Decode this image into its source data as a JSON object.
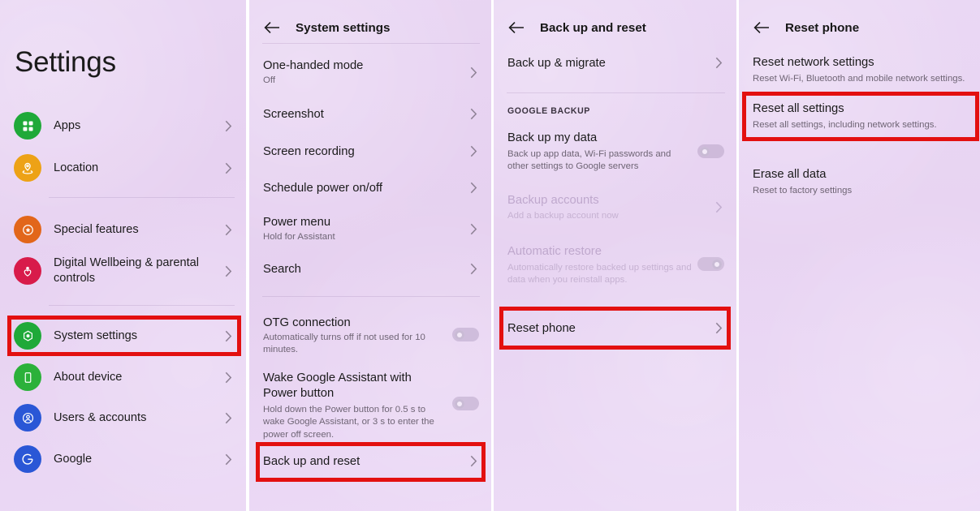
{
  "panels": {
    "settings": {
      "title": "Settings",
      "items": [
        {
          "label": "Apps",
          "icon": "apps-grid-icon",
          "color": "#1fa939"
        },
        {
          "label": "Location",
          "icon": "location-pin-icon",
          "color": "#eda216"
        },
        {
          "label": "Special features",
          "icon": "star-badge-icon",
          "color": "#e2661a"
        },
        {
          "label": "Digital Wellbeing & parental controls",
          "icon": "wellbeing-heart-icon",
          "color": "#d81b4a"
        },
        {
          "label": "System settings",
          "icon": "system-gear-icon",
          "color": "#1fa939"
        },
        {
          "label": "About device",
          "icon": "phone-device-icon",
          "color": "#2bb13a"
        },
        {
          "label": "Users & accounts",
          "icon": "user-account-icon",
          "color": "#2a57d6"
        },
        {
          "label": "Google",
          "icon": "google-g-icon",
          "color": "#2a57d6"
        }
      ],
      "highlighted": "System settings"
    },
    "system_settings": {
      "title": "System settings",
      "back_icon": "back-arrow-icon",
      "items": [
        {
          "title": "One-handed mode",
          "subtitle": "Off",
          "control": "chevron"
        },
        {
          "title": "Screenshot",
          "subtitle": "",
          "control": "chevron"
        },
        {
          "title": "Screen recording",
          "subtitle": "",
          "control": "chevron"
        },
        {
          "title": "Schedule power on/off",
          "subtitle": "",
          "control": "chevron"
        },
        {
          "title": "Power menu",
          "subtitle": "Hold for Assistant",
          "control": "chevron"
        },
        {
          "title": "Search",
          "subtitle": "",
          "control": "chevron"
        },
        {
          "title": "OTG connection",
          "subtitle": "Automatically turns off if not used for 10 minutes.",
          "control": "toggle",
          "toggle_state": "off"
        },
        {
          "title": "Wake Google Assistant with Power button",
          "subtitle": "Hold down the Power button for 0.5 s to wake Google Assistant, or 3 s to enter the power off screen.",
          "control": "toggle",
          "toggle_state": "off"
        },
        {
          "title": "Back up and reset",
          "subtitle": "",
          "control": "chevron"
        }
      ],
      "highlighted": "Back up and reset"
    },
    "backup_reset": {
      "title": "Back up and reset",
      "back_icon": "back-arrow-icon",
      "section_caption": "GOOGLE BACKUP",
      "items": [
        {
          "title": "Back up & migrate",
          "subtitle": "",
          "control": "chevron",
          "disabled": false
        },
        {
          "title": "Back up my data",
          "subtitle": "Back up app data, Wi-Fi passwords and other settings to Google servers",
          "control": "toggle",
          "toggle_state": "off",
          "disabled": false
        },
        {
          "title": "Backup accounts",
          "subtitle": "Add a backup account now",
          "control": "chevron",
          "disabled": true
        },
        {
          "title": "Automatic restore",
          "subtitle": "Automatically restore backed up settings and data when you reinstall apps.",
          "control": "toggle",
          "toggle_state": "on",
          "disabled": true
        },
        {
          "title": "Reset phone",
          "subtitle": "",
          "control": "chevron",
          "disabled": false
        }
      ],
      "highlighted": "Reset phone"
    },
    "reset_phone": {
      "title": "Reset phone",
      "back_icon": "back-arrow-icon",
      "items": [
        {
          "title": "Reset network settings",
          "subtitle": "Reset Wi-Fi, Bluetooth and mobile network settings."
        },
        {
          "title": "Reset all settings",
          "subtitle": "Reset all settings, including network settings."
        },
        {
          "title": "Erase all data",
          "subtitle": "Reset to factory settings"
        }
      ],
      "highlighted": "Reset all settings"
    }
  },
  "theme": {
    "background": "#e8d4f2",
    "highlight_border": "#e31010",
    "primary_text": "#1b1b1b",
    "secondary_text": "#6f6575"
  }
}
